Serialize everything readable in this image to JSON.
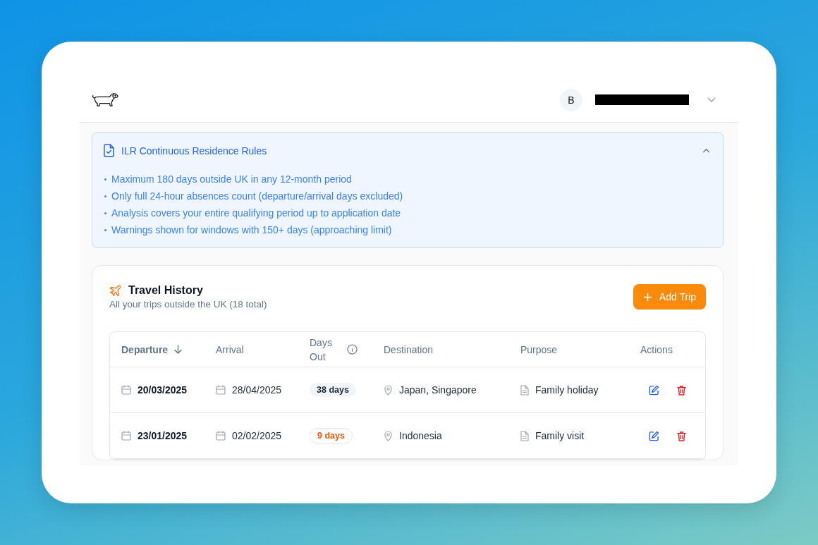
{
  "header": {
    "avatar_initial": "B",
    "account_redacted": true
  },
  "rules": {
    "title": "ILR Continuous Residence Rules",
    "expanded": true,
    "items": [
      "Maximum 180 days outside UK in any 12-month period",
      "Only full 24-hour absences count (departure/arrival days excluded)",
      "Analysis covers your entire qualifying period up to application date",
      "Warnings shown for windows with 150+ days (approaching limit)"
    ]
  },
  "travel": {
    "title": "Travel History",
    "subtitle": "All your trips outside the UK (18 total)",
    "add_button": "Add Trip",
    "columns": [
      {
        "label": "Departure",
        "sorted": true,
        "info": false
      },
      {
        "label": "Arrival",
        "sorted": false,
        "info": false
      },
      {
        "label": "Days Out",
        "sorted": false,
        "info": true
      },
      {
        "label": "Destination",
        "sorted": false,
        "info": false
      },
      {
        "label": "Purpose",
        "sorted": false,
        "info": false
      },
      {
        "label": "Actions",
        "sorted": false,
        "info": false
      }
    ],
    "rows": [
      {
        "departure": "20/03/2025",
        "arrival": "28/04/2025",
        "days": "38 days",
        "kind": "normal",
        "destination": "Japan, Singapore",
        "purpose": "Family holiday"
      },
      {
        "departure": "23/01/2025",
        "arrival": "02/02/2025",
        "days": "9 days",
        "kind": "short",
        "destination": "Indonesia",
        "purpose": "Family visit"
      }
    ]
  }
}
